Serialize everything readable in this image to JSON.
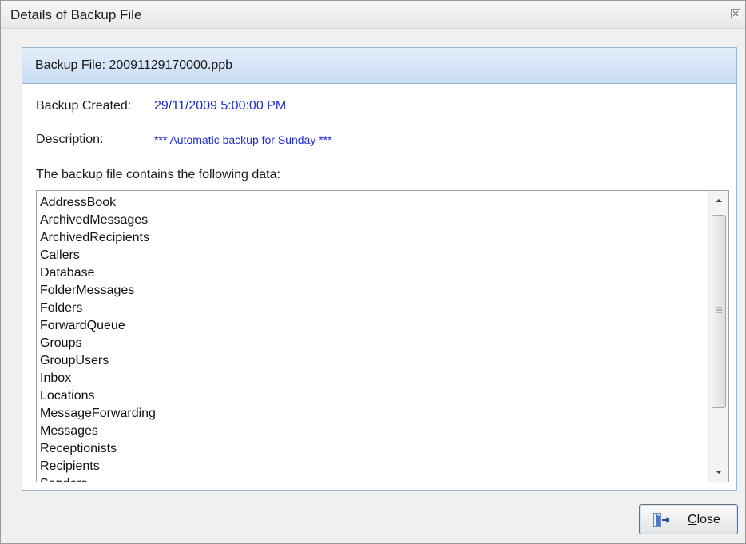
{
  "window": {
    "title": "Details of Backup File"
  },
  "panel": {
    "header": "Backup File: 20091129170000.ppb",
    "created_label": "Backup Created:",
    "created_value": "29/11/2009 5:00:00 PM",
    "description_label": "Description:",
    "description_value": "*** Automatic backup for Sunday ***",
    "contains_label": "The backup file contains the following data:",
    "value_color": "#1d2bd6"
  },
  "data_list": {
    "items": [
      "AddressBook",
      "ArchivedMessages",
      "ArchivedRecipients",
      "Callers",
      "Database",
      "FolderMessages",
      "Folders",
      "ForwardQueue",
      "Groups",
      "GroupUsers",
      "Inbox",
      "Locations",
      "MessageForwarding",
      "Messages",
      "Receptionists",
      "Recipients",
      "Senders"
    ]
  },
  "footer": {
    "close_button": {
      "mnemonic": "C",
      "rest": "lose",
      "icon": "exit-door-icon"
    }
  }
}
